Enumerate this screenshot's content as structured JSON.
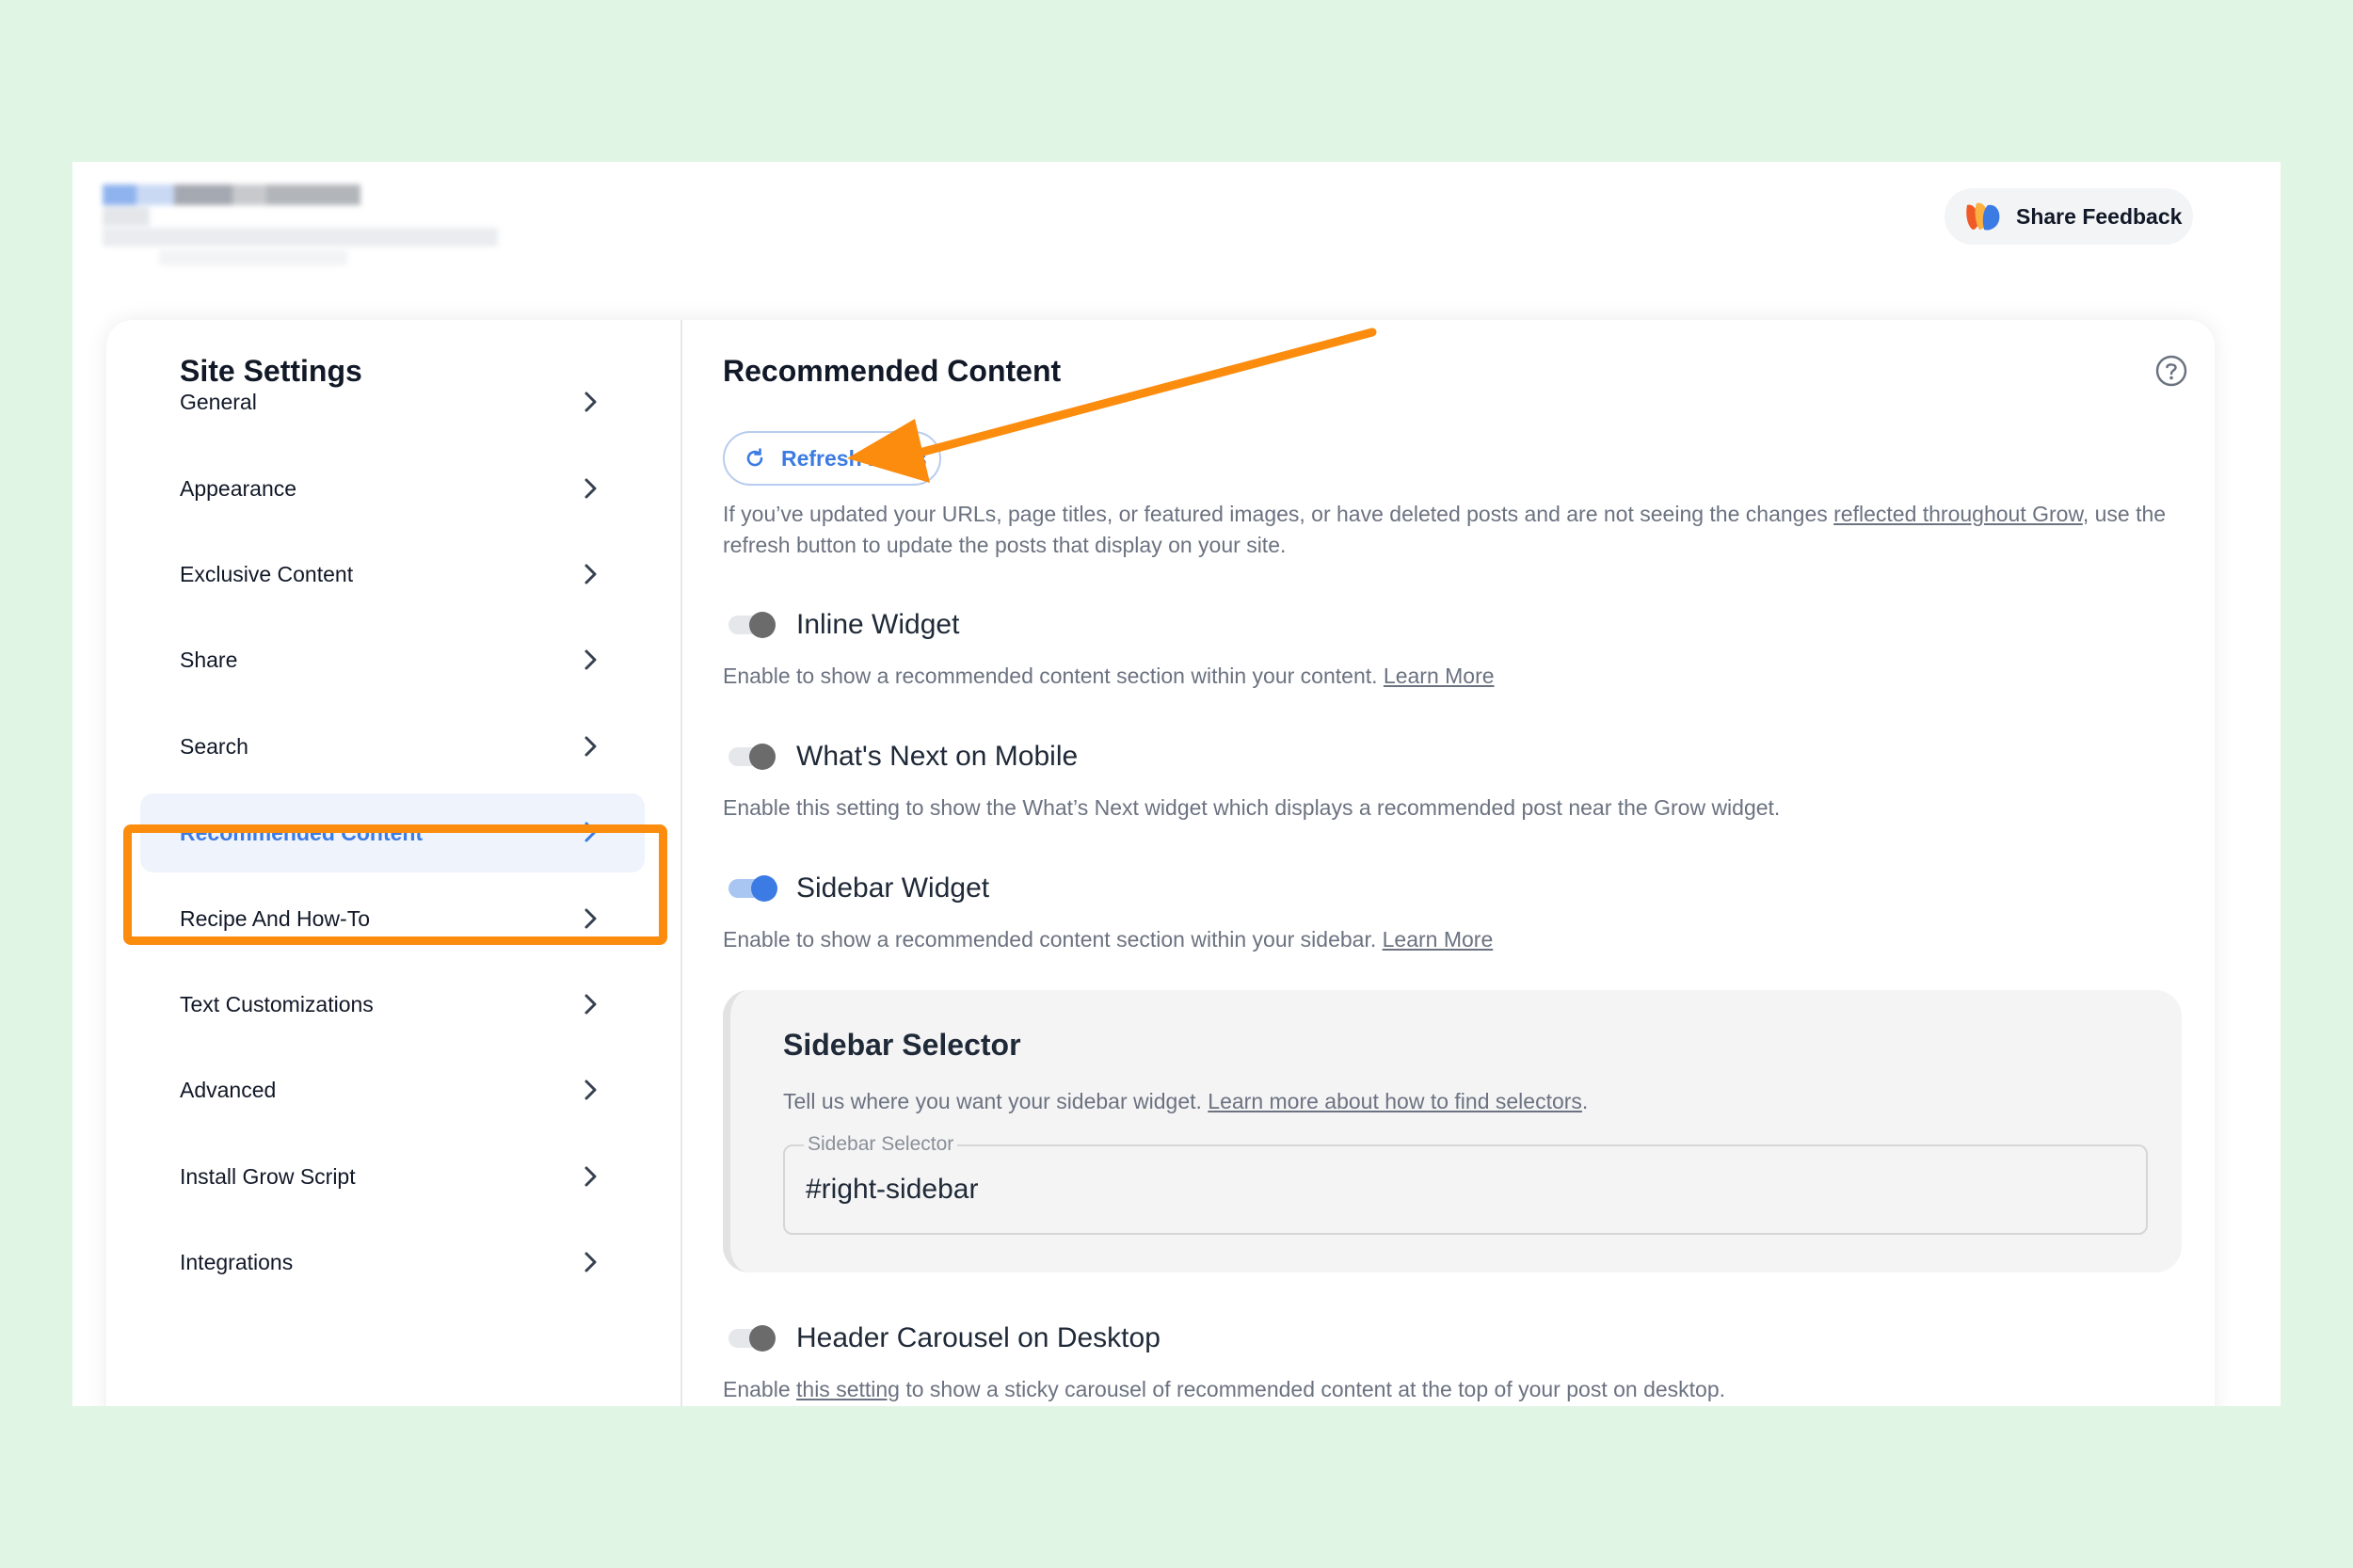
{
  "header": {
    "feedback_label": "Share Feedback"
  },
  "sidebar": {
    "title": "Site Settings",
    "items": [
      {
        "label": "General"
      },
      {
        "label": "Appearance"
      },
      {
        "label": "Exclusive Content"
      },
      {
        "label": "Share"
      },
      {
        "label": "Search"
      },
      {
        "label": "Recommended Content",
        "active": true
      },
      {
        "label": "Recipe And How-To"
      },
      {
        "label": "Text Customizations"
      },
      {
        "label": "Advanced"
      },
      {
        "label": "Install Grow Script"
      },
      {
        "label": "Integrations"
      }
    ]
  },
  "main": {
    "title": "Recommended Content",
    "refresh_label": "Refresh Posts",
    "refresh_desc_before": "If you’ve updated your URLs, page titles, or featured images, or have deleted posts and are not seeing the changes ",
    "refresh_desc_link": "reflected throughout Grow",
    "refresh_desc_after": ", use the refresh button to update the posts that display on your site.",
    "settings": {
      "inline": {
        "label": "Inline Widget",
        "enabled": false,
        "desc": "Enable to show a recommended content section within your content. ",
        "link": "Learn More"
      },
      "whats_next": {
        "label": "What's Next on Mobile",
        "enabled": false,
        "desc": "Enable this setting to show the What’s Next widget which displays a recommended post near the Grow widget."
      },
      "sidebar_widget": {
        "label": "Sidebar Widget",
        "enabled": true,
        "desc": "Enable to show a recommended content section within your sidebar. ",
        "link": "Learn More"
      },
      "header_carousel": {
        "label": "Header Carousel on Desktop",
        "enabled": false,
        "desc_before": "Enable ",
        "desc_link": "this setting",
        "desc_after": " to show a sticky carousel of recommended content at the top of your post on desktop."
      }
    },
    "sidebar_selector": {
      "title": "Sidebar Selector",
      "desc": "Tell us where you want your sidebar widget. ",
      "link": "Learn more about how to find selectors",
      "link_after": ".",
      "field_label": "Sidebar Selector",
      "value": "#right-sidebar"
    }
  },
  "colors": {
    "accent": "#3b7be3",
    "highlight": "#fb8c0e",
    "page_background": "#e1f5e5"
  },
  "icons": [
    "grow-logo-icon",
    "chevron-right-icon",
    "help-circle-icon",
    "refresh-icon",
    "annotation-arrow"
  ]
}
